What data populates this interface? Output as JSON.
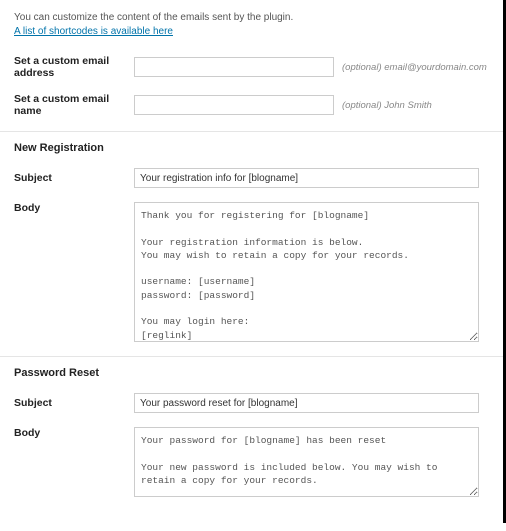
{
  "intro": {
    "text": "You can customize the content of the emails sent by the plugin.",
    "link_text": "A list of shortcodes is available here"
  },
  "custom_email": {
    "address_label": "Set a custom email address",
    "address_value": "",
    "address_hint": "(optional) email@yourdomain.com",
    "name_label": "Set a custom email name",
    "name_value": "",
    "name_hint": "(optional) John Smith"
  },
  "new_registration": {
    "heading": "New Registration",
    "subject_label": "Subject",
    "subject_value": "Your registration info for [blogname]",
    "body_label": "Body",
    "body_value": "Thank you for registering for [blogname]\n\nYour registration information is below.\nYou may wish to retain a copy for your records.\n\nusername: [username]\npassword: [password]\n\nYou may login here:\n[reglink]\n\nYou may change your password here:\n[members-area]"
  },
  "password_reset": {
    "heading": "Password Reset",
    "subject_label": "Subject",
    "subject_value": "Your password reset for [blogname]",
    "body_label": "Body",
    "body_value": "Your password for [blogname] has been reset\n\nYour new password is included below. You may wish to retain a copy for your records.\n\npassword: [password]"
  }
}
